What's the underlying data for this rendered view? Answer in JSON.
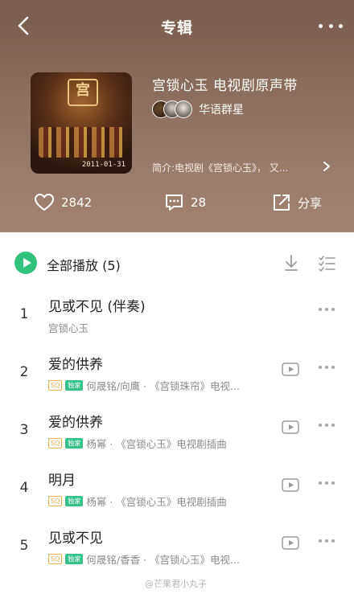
{
  "header": {
    "title": "专辑",
    "album_name": "宫锁心玉 电视剧原声带",
    "artist": "华语群星",
    "intro": "简介:电视剧《宫锁心玉》， 又...",
    "cover_date": "2011-01-31",
    "cover_sign": "宫",
    "stats": {
      "likes": "2842",
      "comments": "28",
      "share_label": "分享"
    }
  },
  "list": {
    "play_all_label": "全部播放 (5)",
    "tracks": [
      {
        "num": "1",
        "name": "见或不见 (伴奏)",
        "sub": "宫锁心玉",
        "sq": "",
        "exclusive": "",
        "has_mv": false
      },
      {
        "num": "2",
        "name": "爱的供养",
        "sub": "何晟铭/向鹰 · 《宫锁珠帘》电视...",
        "sq": "SQ",
        "exclusive": "独家",
        "has_mv": true
      },
      {
        "num": "3",
        "name": "爱的供养",
        "sub": "杨幂 · 《宫锁心玉》电视剧插曲",
        "sq": "SQ",
        "exclusive": "独家",
        "has_mv": true
      },
      {
        "num": "4",
        "name": "明月",
        "sub": "杨幂 · 《宫锁心玉》电视剧插曲",
        "sq": "SQ",
        "exclusive": "独家",
        "has_mv": true
      },
      {
        "num": "5",
        "name": "见或不见",
        "sub": "何晟铭/香香 · 《宫锁心玉》电视...",
        "sq": "SQ",
        "exclusive": "独家",
        "has_mv": true
      }
    ]
  },
  "watermark": "@芒果君小丸子",
  "colors": {
    "accent": "#31c27c"
  }
}
